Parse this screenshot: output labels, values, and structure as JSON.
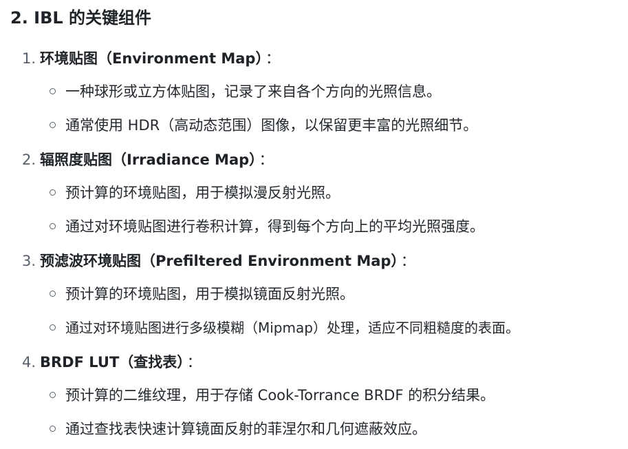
{
  "section": {
    "title": "2. IBL 的关键组件"
  },
  "items": [
    {
      "number": "1.",
      "title": "环境贴图（Environment Map）",
      "colon": "：",
      "bullets": [
        "一种球形或立方体贴图，记录了来自各个方向的光照信息。",
        "通常使用 HDR（高动态范围）图像，以保留更丰富的光照细节。"
      ]
    },
    {
      "number": "2.",
      "title": "辐照度贴图（Irradiance Map）",
      "colon": "：",
      "bullets": [
        "预计算的环境贴图，用于模拟漫反射光照。",
        "通过对环境贴图进行卷积计算，得到每个方向上的平均光照强度。"
      ]
    },
    {
      "number": "3.",
      "title": "预滤波环境贴图（Prefiltered Environment Map）",
      "colon": "：",
      "bullets": [
        "预计算的环境贴图，用于模拟镜面反射光照。",
        "通过对环境贴图进行多级模糊（Mipmap）处理，适应不同粗糙度的表面。"
      ]
    },
    {
      "number": "4.",
      "title": "BRDF LUT（查找表）",
      "colon": "：",
      "bullets": [
        "预计算的二维纹理，用于存储 Cook-Torrance BRDF 的积分结果。",
        "通过查找表快速计算镜面反射的菲涅尔和几何遮蔽效应。"
      ]
    }
  ]
}
